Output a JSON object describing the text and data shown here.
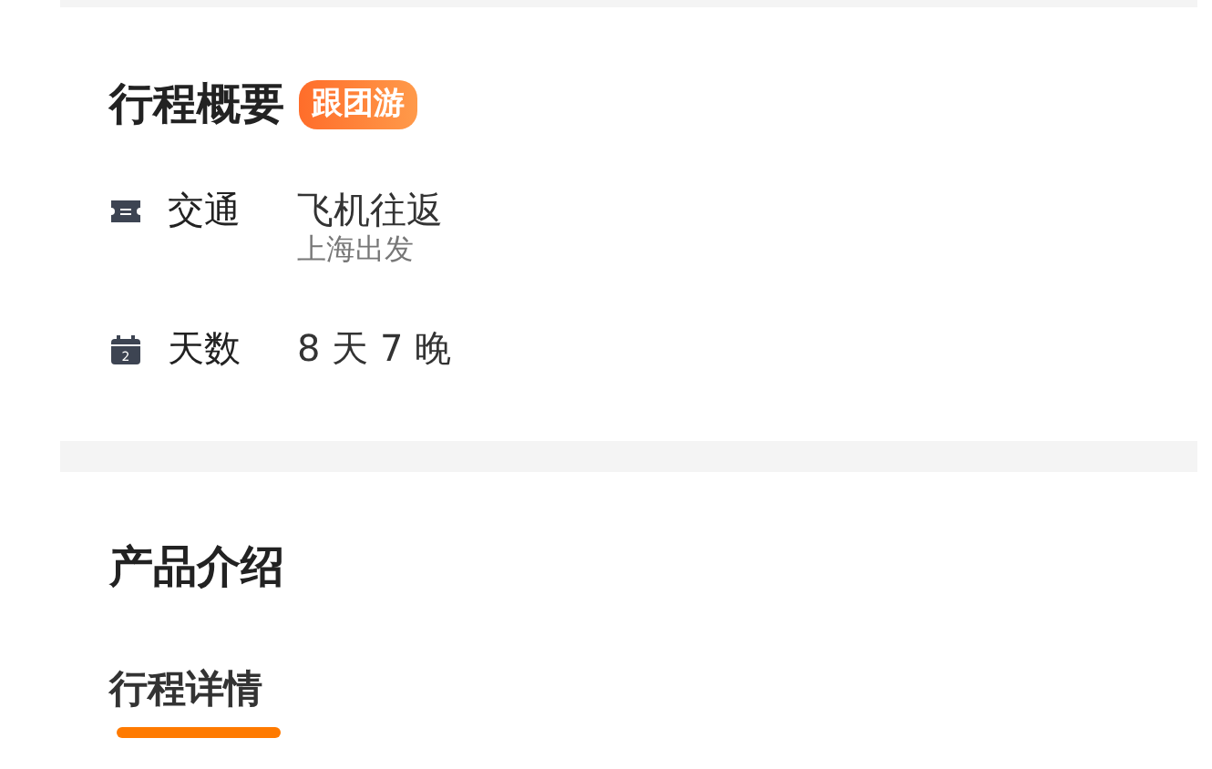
{
  "overview": {
    "title": "行程概要",
    "badge": "跟团游",
    "rows": [
      {
        "kind": "ticket",
        "label": "交通",
        "value": "飞机往返",
        "note": "上海出发"
      },
      {
        "kind": "calendar",
        "label": "天数",
        "value": "8 天 7 晚",
        "icon_text": "2"
      }
    ]
  },
  "product": {
    "title": "产品介绍",
    "tabs": [
      {
        "label": "行程详情",
        "selected": true
      }
    ]
  }
}
